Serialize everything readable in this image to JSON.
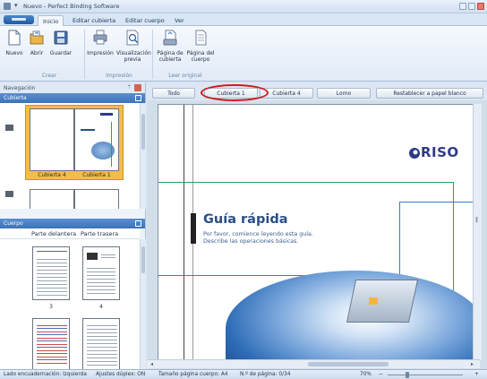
{
  "window": {
    "title": "Nuevo - Perfect Binding Software"
  },
  "ribbon_tabs": [
    "Inicio",
    "Editar cubierta",
    "Editar cuerpo",
    "Ver"
  ],
  "ribbon": {
    "buttons": {
      "nuevo": "Nuevo",
      "abrir": "Abrir",
      "guardar": "Guardar",
      "impresion": "Impresión",
      "vis_line1": "Visualización",
      "vis_line2": "previa",
      "pc_line1": "Página de",
      "pc_line2": "cubierta",
      "pcu_line1": "Página del",
      "pcu_line2": "cuerpo"
    },
    "groups": [
      "Crear",
      "Impresión",
      "Leer original"
    ]
  },
  "navigation": {
    "title": "Navegación",
    "pin": "ᛘ",
    "cover_section": "Cubierta",
    "cover_labels": [
      "Cubierta 4",
      "Cubierta 1"
    ],
    "body_section": "Cuerpo",
    "body_columns": [
      "Parte delantera",
      "Parte trasera"
    ],
    "page_numbers": [
      "3",
      "4"
    ]
  },
  "page_tabs": {
    "todo": "Todo",
    "cubierta1": "Cubierta 1",
    "cubierta4": "Cubierta 4",
    "lomo": "Lomo",
    "reset": "Restablecer a papel blanco"
  },
  "document": {
    "brand": "RISO",
    "title": "Guía rápida",
    "subtitle_line1": "Por favor, comience leyendo esta guía.",
    "subtitle_line2": "Describe las operaciones básicas."
  },
  "status_bar": {
    "binding": "Lado encuadernación: Izquierda",
    "duplex": "Ajustes dúplex: ON",
    "page_size": "Tamaño página cuerpo: A4",
    "page_count": "N.º de página: 0/34",
    "zoom": "70%",
    "zoom_out": "−",
    "zoom_in": "+"
  },
  "colors": {
    "accent_blue": "#3c72b8",
    "selection": "#f4bd47",
    "highlight_ring": "#d4161b",
    "riso_navy": "#2d3a86",
    "line_green": "#20a94a"
  }
}
